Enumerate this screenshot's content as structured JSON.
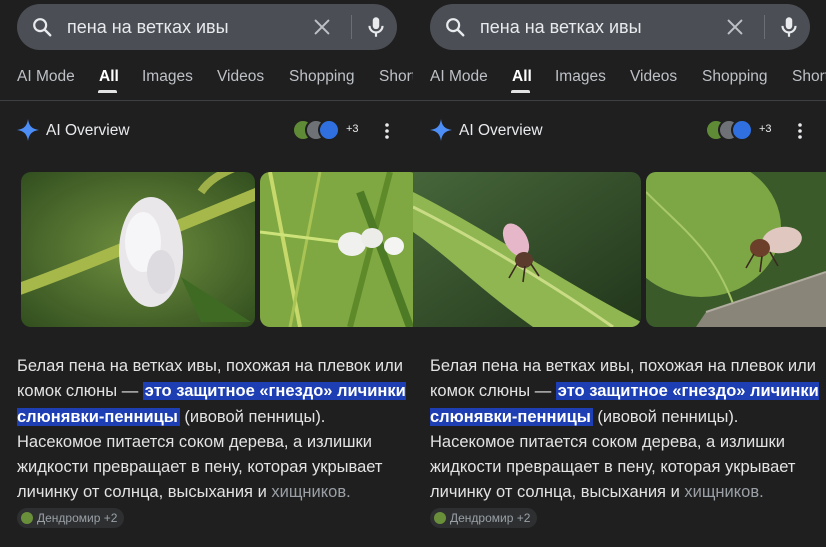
{
  "search": {
    "query": "пена на ветках ивы",
    "icons": {
      "search": "search-icon",
      "clear": "close-icon",
      "mic": "mic-icon"
    }
  },
  "tabs": [
    "AI Mode",
    "All",
    "Images",
    "Videos",
    "Shopping",
    "Short"
  ],
  "active_tab": "All",
  "overview": {
    "title": "AI Overview",
    "more_count": "+3",
    "icons": {
      "spark": "sparkle-icon",
      "menu": "more-vert-icon"
    }
  },
  "answer": {
    "part1": "Белая пена на ветках ивы, похожая на плевок или комок слюны — ",
    "highlight": "это защитное «гнездо» личинки слюнявки-пенницы",
    "part2": " (ивовой пенницы). Насекомое питается соком дерева, а излишки жидкости превращает в пену, которая укрывает личинку от солнца, высыхания и ",
    "tail": "хищников.",
    "source_chip": "Дендромир +2"
  },
  "colors": {
    "background": "#1f1f1f",
    "search_bar": "#4b4f55",
    "highlight": "#1d3fb3",
    "spark_blue": "#4c8df6"
  }
}
